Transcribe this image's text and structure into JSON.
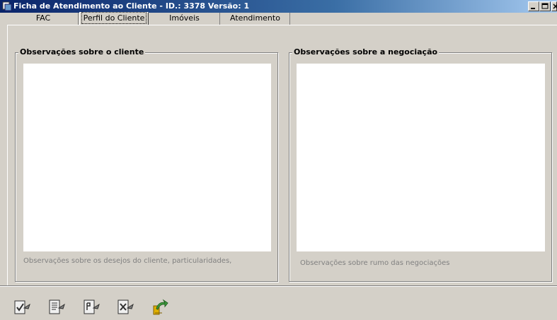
{
  "window": {
    "title": "Ficha de Atendimento ao Cliente - ID.: 3378 Versão: 1"
  },
  "tabs": [
    {
      "label": "FAC",
      "active": false
    },
    {
      "label": "Perfil do Cliente",
      "active": true
    },
    {
      "label": "Imóveis",
      "active": false
    },
    {
      "label": "Atendimento",
      "active": false
    }
  ],
  "left_group": {
    "title": "Observações sobre o cliente",
    "hint": "Observações sobre os desejos do cliente, particularidades,"
  },
  "right_group": {
    "title": "Observações sobre a negociação",
    "hint": "Observações sobre rumo das negociações"
  },
  "toolbar": {
    "icons": [
      "confirm-icon",
      "document-edit-icon",
      "document-next-icon",
      "cancel-document-icon",
      "exit-icon"
    ]
  },
  "colors": {
    "title_bar_start": "#0a246a",
    "title_bar_end": "#a6caf0",
    "face": "#d4d0c8"
  }
}
